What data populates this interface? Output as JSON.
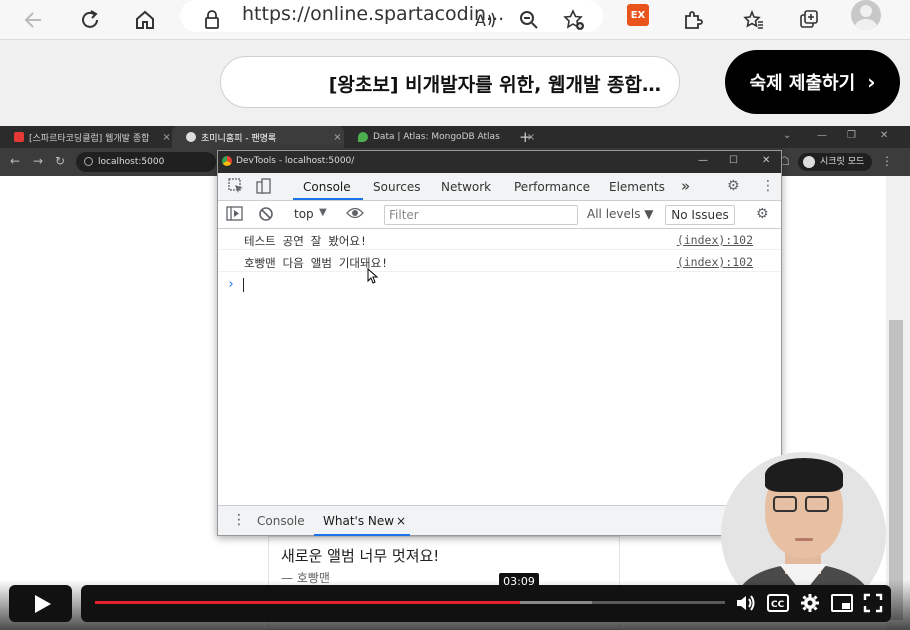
{
  "browser": {
    "url": "https://online.spartacodin...",
    "extension_badge": "EX"
  },
  "lecture": {
    "title": "[왕초보] 비개발자를 위한, 웹개발 종합…",
    "submit_label": "숙제 제출하기",
    "submit_chevron": "›"
  },
  "inner_browser": {
    "tabs": [
      {
        "label": "[스파르타코딩클럽] 웹개발 종합",
        "close": "×"
      },
      {
        "label": "초미니홈피 - 팬명록",
        "close": "×"
      },
      {
        "label": "Data | Atlas: MongoDB Atlas",
        "close": "×"
      }
    ],
    "new_tab": "+",
    "url": "localhost:5000",
    "secret_mode": "시크릿 모드"
  },
  "devtools": {
    "title": "DevTools - localhost:5000/",
    "tabs": [
      "Console",
      "Sources",
      "Network",
      "Performance",
      "Elements"
    ],
    "more_tabs": "»",
    "context": "top",
    "filter_placeholder": "Filter",
    "levels": "All levels ▼",
    "issues": "No Issues",
    "console_lines": [
      {
        "message": "테스트 공연 잘 봤어요!",
        "source": "(index):102"
      },
      {
        "message": "호빵맨 다음 앨범 기대돼요!",
        "source": "(index):102"
      }
    ],
    "prompt": "›",
    "drawer_menu": "⋮",
    "drawer_tabs": [
      "Console",
      "What's New"
    ],
    "drawer_close": "×"
  },
  "page": {
    "card_text": "새로운 앨범 너무 멋져요!",
    "card_author": "— 호빵맨"
  },
  "video": {
    "time_tooltip": "03:09",
    "progress_fraction": 0.674,
    "buffered_fraction": 0.789,
    "progress_color": "#e4202e"
  }
}
